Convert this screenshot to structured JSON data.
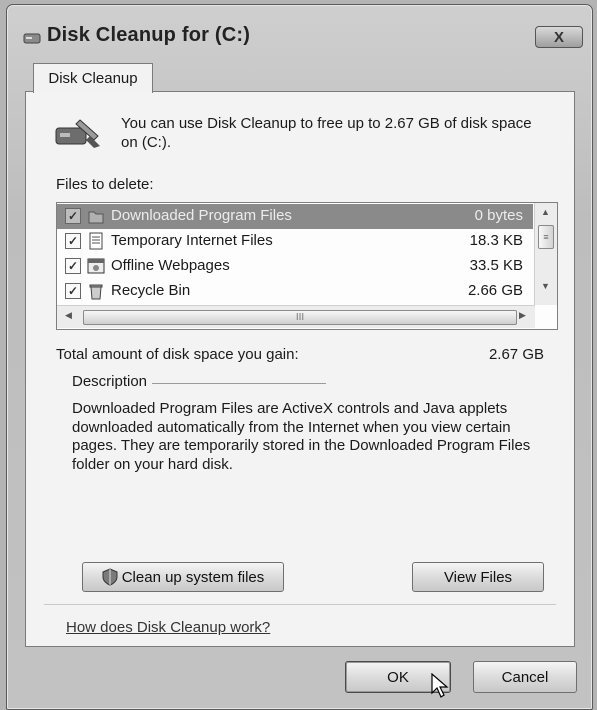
{
  "window": {
    "title": "Disk Cleanup for  (C:)",
    "close_label": "X"
  },
  "tab": {
    "label": "Disk Cleanup"
  },
  "header": {
    "text": "You can use Disk Cleanup to free up to 2.67 GB of disk space on  (C:)."
  },
  "files": {
    "label": "Files to delete:",
    "items": [
      {
        "name": "Downloaded Program Files",
        "size": "0 bytes",
        "checked": true,
        "selected": true,
        "icon": "folder-icon"
      },
      {
        "name": "Temporary Internet Files",
        "size": "18.3 KB",
        "checked": true,
        "selected": false,
        "icon": "document-icon"
      },
      {
        "name": "Offline Webpages",
        "size": "33.5 KB",
        "checked": true,
        "selected": false,
        "icon": "webpage-icon"
      },
      {
        "name": "Recycle Bin",
        "size": "2.66 GB",
        "checked": true,
        "selected": false,
        "icon": "recycle-bin-icon"
      }
    ],
    "hscroll_grip": "III"
  },
  "total": {
    "label": "Total amount of disk space you gain:",
    "value": "2.67 GB"
  },
  "description": {
    "legend": "Description",
    "text": "Downloaded Program Files are ActiveX controls and Java applets downloaded automatically from the Internet when you view certain pages. They are temporarily stored in the Downloaded Program Files folder on your hard disk."
  },
  "buttons": {
    "cleanup_system": "Clean up system files",
    "view_files": "View Files",
    "ok": "OK",
    "cancel": "Cancel"
  },
  "help_link": "How does Disk Cleanup work?"
}
